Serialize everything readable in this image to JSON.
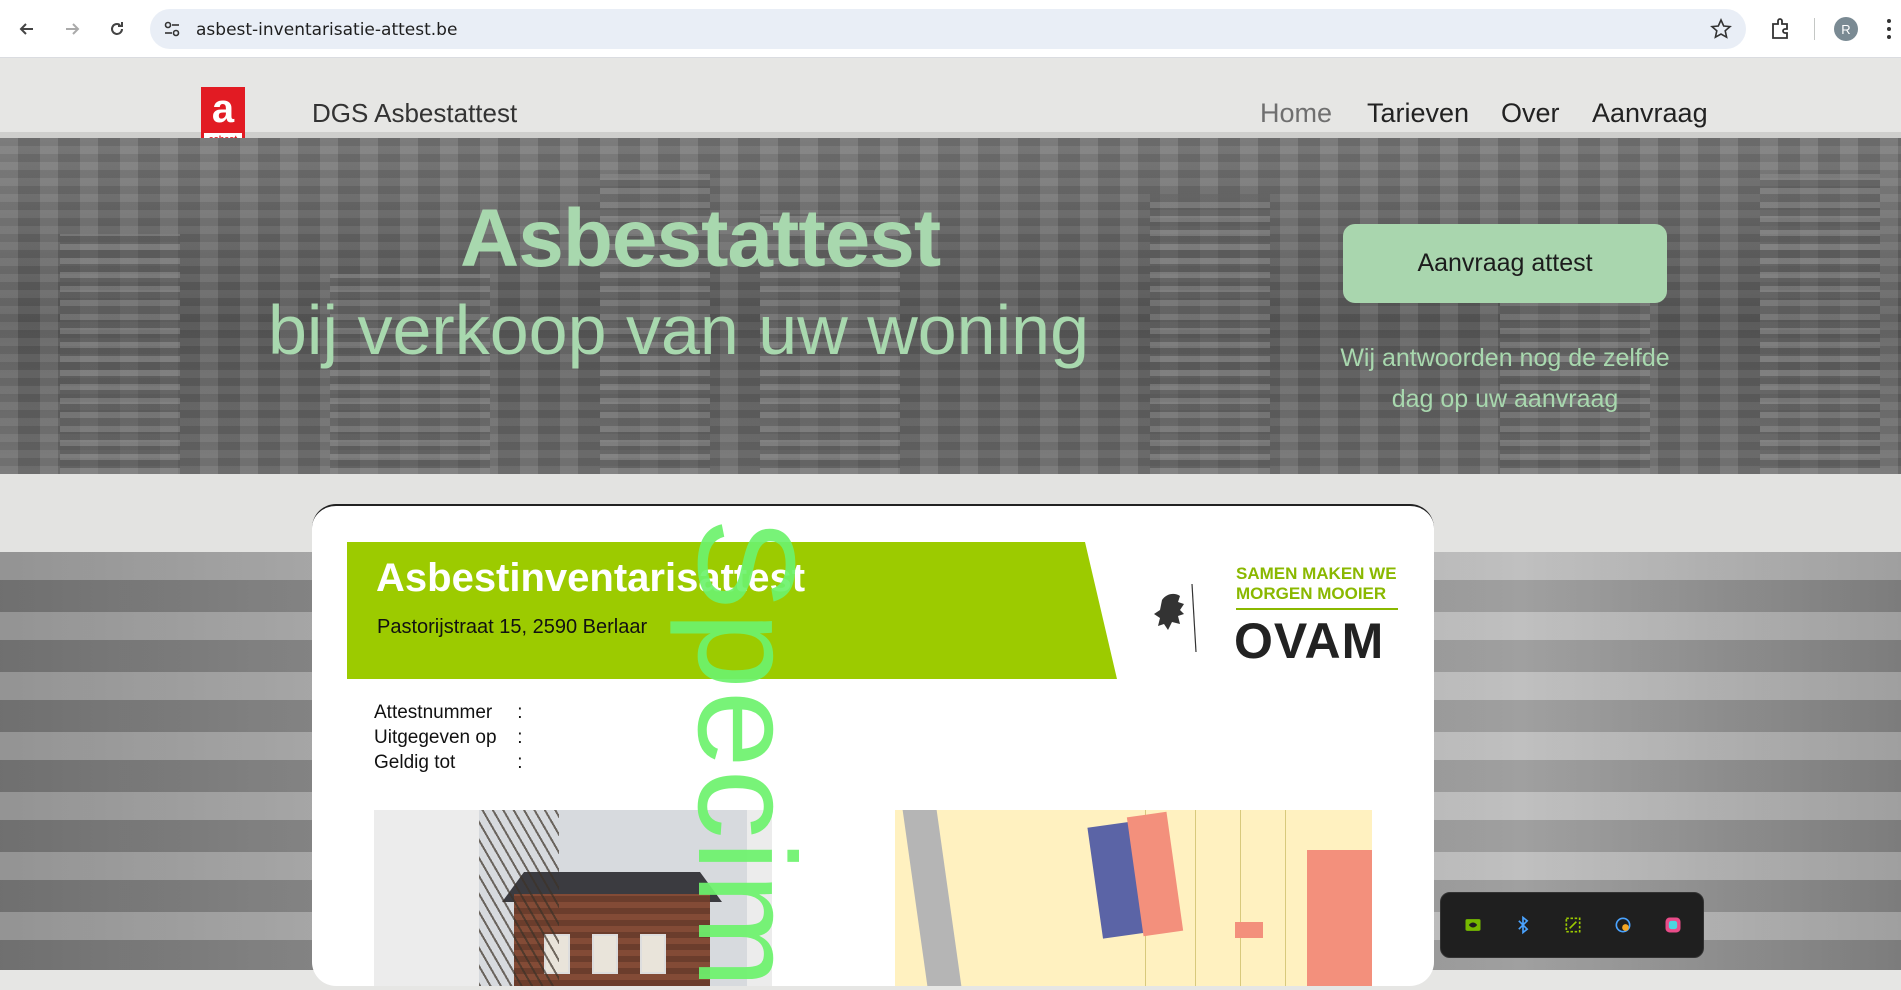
{
  "browser": {
    "url": "asbest-inventarisatie-attest.be",
    "profile_initial": "R"
  },
  "site": {
    "logo_letter": "a",
    "logo_tag": "asbest",
    "name": "DGS Asbestattest",
    "menu": [
      {
        "label": "Home",
        "active": true
      },
      {
        "label": "Tarieven",
        "active": false
      },
      {
        "label": "Over",
        "active": false
      },
      {
        "label": "Aanvraag",
        "active": false
      }
    ]
  },
  "hero": {
    "title": "Asbestattest",
    "subtitle": "bij verkoop van uw woning",
    "cta_label": "Aanvraag attest",
    "note_line1": "Wij antwoorden nog de zelfde",
    "note_line2": "dag op uw aanvraag"
  },
  "document": {
    "title": "Asbestinventarisattest",
    "address": "Pastorijstraat 15, 2590 Berlaar",
    "org_slogan_line1": "SAMEN MAKEN WE",
    "org_slogan_line2": "MORGEN MOOIER",
    "org_name": "OVAM",
    "meta": [
      {
        "label": "Attestnummer",
        "colon": ":"
      },
      {
        "label": "Uitgegeven op",
        "colon": ":"
      },
      {
        "label": "Geldig tot",
        "colon": ":"
      }
    ],
    "watermark": "Specim"
  },
  "tray": {
    "icons": [
      "nvidia-icon",
      "bluetooth-icon",
      "snipping-tool-icon",
      "onedrive-icon",
      "color-app-icon"
    ]
  },
  "colors": {
    "accent_green": "#a8d8ae",
    "banner_green": "#9ccb00",
    "logo_red": "#e21b23"
  }
}
